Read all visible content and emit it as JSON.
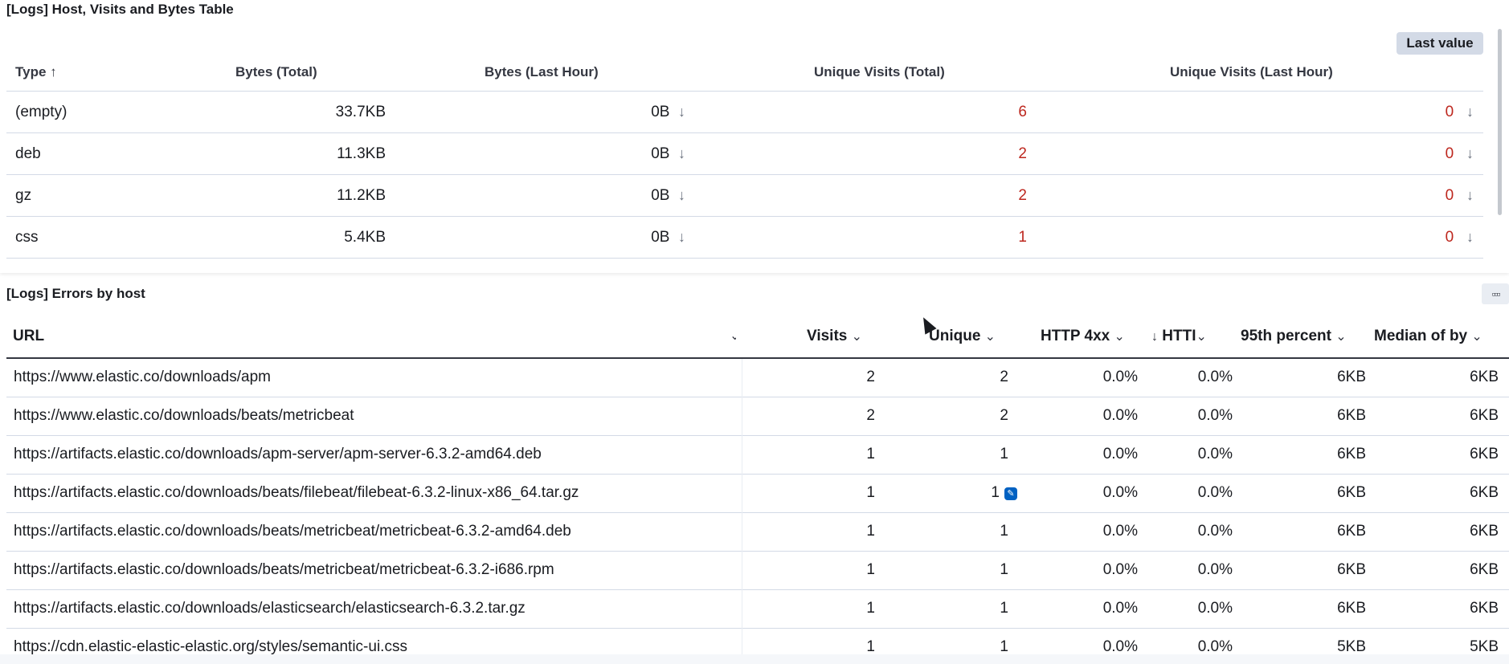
{
  "panel1": {
    "title": "[Logs] Host, Visits and Bytes Table",
    "last_value_label": "Last value",
    "columns": [
      "Type",
      "Bytes (Total)",
      "Bytes (Last Hour)",
      "Unique Visits (Total)",
      "Unique Visits (Last Hour)"
    ],
    "sort_icon": "↑",
    "rows": [
      {
        "type": "(empty)",
        "bytes_total": "33.7KB",
        "bytes_last": "0B",
        "visits_total": "6",
        "visits_last": "0"
      },
      {
        "type": "deb",
        "bytes_total": "11.3KB",
        "bytes_last": "0B",
        "visits_total": "2",
        "visits_last": "0"
      },
      {
        "type": "gz",
        "bytes_total": "11.2KB",
        "bytes_last": "0B",
        "visits_total": "2",
        "visits_last": "0"
      },
      {
        "type": "css",
        "bytes_total": "5.4KB",
        "bytes_last": "0B",
        "visits_total": "1",
        "visits_last": "0"
      }
    ],
    "trend_icon": "↓",
    "accent_red": "#bd271e"
  },
  "panel2": {
    "title": "[Logs] Errors by host",
    "menu_icon": "▫▫▫",
    "columns": {
      "url": "URL",
      "visits": "Visits",
      "unique": "Unique",
      "http4xx": "HTTP 4xx",
      "http5xx": "HTTI",
      "p95": "95th percent",
      "median": "Median of by"
    },
    "chevron": "⌄",
    "sort_down": "↓",
    "rows": [
      {
        "url": "https://www.elastic.co/downloads/apm",
        "visits": "2",
        "unique": "2",
        "h4": "0.0%",
        "h5": "0.0%",
        "p95": "6KB",
        "median": "6KB"
      },
      {
        "url": "https://www.elastic.co/downloads/beats/metricbeat",
        "visits": "2",
        "unique": "2",
        "h4": "0.0%",
        "h5": "0.0%",
        "p95": "6KB",
        "median": "6KB"
      },
      {
        "url": "https://artifacts.elastic.co/downloads/apm-server/apm-server-6.3.2-amd64.deb",
        "visits": "1",
        "unique": "1",
        "h4": "0.0%",
        "h5": "0.0%",
        "p95": "6KB",
        "median": "6KB"
      },
      {
        "url": "https://artifacts.elastic.co/downloads/beats/filebeat/filebeat-6.3.2-linux-x86_64.tar.gz",
        "visits": "1",
        "unique": "1",
        "h4": "0.0%",
        "h5": "0.0%",
        "p95": "6KB",
        "median": "6KB"
      },
      {
        "url": "https://artifacts.elastic.co/downloads/beats/metricbeat/metricbeat-6.3.2-amd64.deb",
        "visits": "1",
        "unique": "1",
        "h4": "0.0%",
        "h5": "0.0%",
        "p95": "6KB",
        "median": "6KB"
      },
      {
        "url": "https://artifacts.elastic.co/downloads/beats/metricbeat/metricbeat-6.3.2-i686.rpm",
        "visits": "1",
        "unique": "1",
        "h4": "0.0%",
        "h5": "0.0%",
        "p95": "6KB",
        "median": "6KB"
      },
      {
        "url": "https://artifacts.elastic.co/downloads/elasticsearch/elasticsearch-6.3.2.tar.gz",
        "visits": "1",
        "unique": "1",
        "h4": "0.0%",
        "h5": "0.0%",
        "p95": "6KB",
        "median": "6KB"
      },
      {
        "url": "https://cdn.elastic-elastic-elastic.org/styles/semantic-ui.css",
        "visits": "1",
        "unique": "1",
        "h4": "0.0%",
        "h5": "0.0%",
        "p95": "5KB",
        "median": "5KB"
      }
    ],
    "edit_icon": "✎",
    "accent_blue": "#0061c2"
  }
}
